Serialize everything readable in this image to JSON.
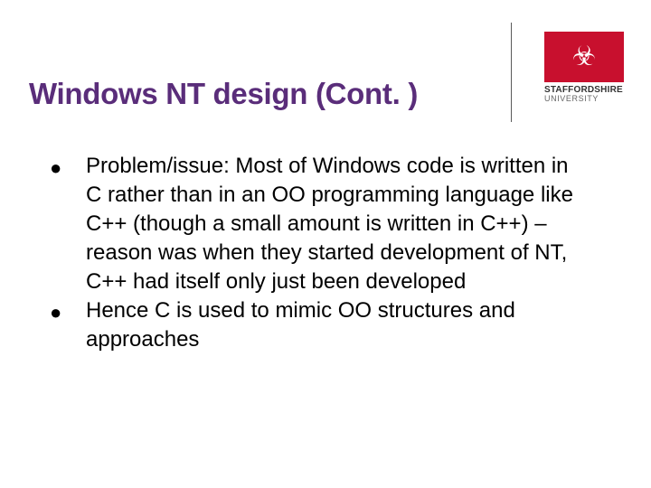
{
  "title": "Windows NT design (Cont. )",
  "logo": {
    "line1": "STAFFORDSHIRE",
    "line2": "UNIVERSITY"
  },
  "bullets": [
    "Problem/issue: Most of Windows code is written in C rather than in an OO programming language like C++ (though a small amount is written in C++) – reason was when they started development of NT, C++ had itself only just been developed",
    "Hence C is used to mimic OO structures and approaches"
  ],
  "bullet_marker": "●"
}
